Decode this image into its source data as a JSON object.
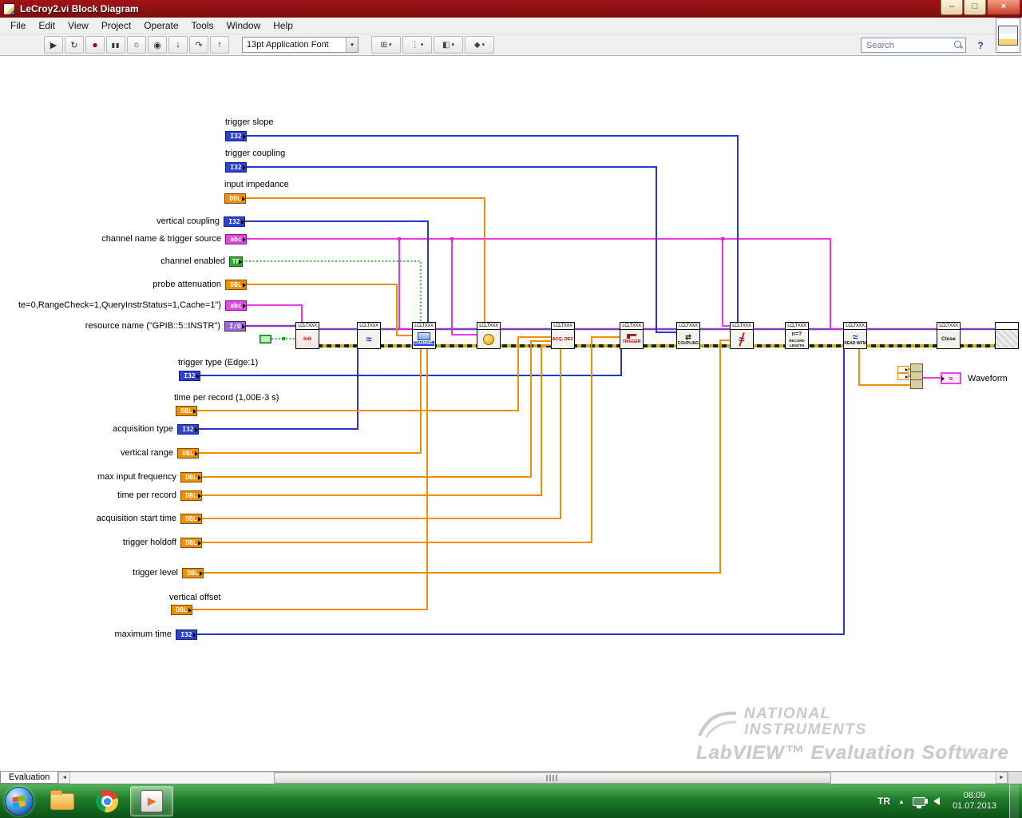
{
  "window": {
    "title": "LeCroy2.vi Block Diagram",
    "minimize_glyph": "–",
    "maximize_glyph": "□",
    "close_glyph": "×"
  },
  "menubar": {
    "items": [
      "File",
      "Edit",
      "View",
      "Project",
      "Operate",
      "Tools",
      "Window",
      "Help"
    ]
  },
  "toolbar": {
    "buttons": [
      {
        "id": "run",
        "glyph": "▶"
      },
      {
        "id": "run-continuously",
        "glyph": "↻"
      },
      {
        "id": "abort",
        "glyph": "●"
      },
      {
        "id": "pause",
        "glyph": "▮▮"
      },
      {
        "id": "highlight-execution",
        "glyph": "☼"
      },
      {
        "id": "retain-wire-values",
        "glyph": "◉"
      },
      {
        "id": "step-into",
        "glyph": "↓"
      },
      {
        "id": "step-over",
        "glyph": "↷"
      },
      {
        "id": "step-out",
        "glyph": "↑"
      }
    ],
    "font_selector": "13pt Application Font",
    "caret": "▾",
    "dropdowns": [
      {
        "id": "align-objects",
        "glyph": "⊞"
      },
      {
        "id": "distribute-objects",
        "glyph": "⋮"
      },
      {
        "id": "reorder-objects",
        "glyph": "◧"
      },
      {
        "id": "clean-up-diagram",
        "glyph": "◆"
      }
    ],
    "search_placeholder": "Search",
    "help_glyph": "?"
  },
  "diagram": {
    "terminals": [
      {
        "label": "trigger slope",
        "type": "I32"
      },
      {
        "label": "trigger coupling",
        "type": "I32"
      },
      {
        "label": "input impedance",
        "type": "DBL"
      },
      {
        "label": "vertical coupling",
        "type": "I32"
      },
      {
        "label": "channel name & trigger source",
        "type": "abc"
      },
      {
        "label": "channel enabled",
        "type": "TF"
      },
      {
        "label": "probe attenuation",
        "type": "DBL"
      },
      {
        "label": "te=0,RangeCheck=1,QueryInstrStatus=1,Cache=1\")",
        "type": "abc"
      },
      {
        "label": "resource name (\"GPIB::5::INSTR\")",
        "type": "I/O"
      },
      {
        "label": "trigger type (Edge:1)",
        "type": "I32"
      },
      {
        "label": "time per record (1,00E-3 s)",
        "type": "DBL"
      },
      {
        "label": "acquisition type",
        "type": "I32"
      },
      {
        "label": "vertical range",
        "type": "DBL"
      },
      {
        "label": "max input frequency",
        "type": "DBL"
      },
      {
        "label": "time per record",
        "type": "DBL"
      },
      {
        "label": "acquisition start time",
        "type": "DBL"
      },
      {
        "label": "trigger holdoff",
        "type": "DBL"
      },
      {
        "label": "trigger level",
        "type": "DBL"
      },
      {
        "label": "vertical offset",
        "type": "DBL"
      },
      {
        "label": "maximum time",
        "type": "I32"
      }
    ],
    "nodes": [
      {
        "header": "LCLTXXX",
        "caption": "Init",
        "glyph": ""
      },
      {
        "header": "LCLTXXX",
        "caption": "",
        "glyph": "≈"
      },
      {
        "header": "LCLTXXX",
        "caption": "CHANNEL",
        "glyph": ""
      },
      {
        "header": "LCLTXXX",
        "caption": "",
        "glyph": ""
      },
      {
        "header": "LCLTXXX",
        "caption": "ACQ. REC",
        "glyph": ""
      },
      {
        "header": "LCLTXXX",
        "caption": "TRIGGER",
        "glyph": ""
      },
      {
        "header": "LCLTXXX",
        "caption": "COUPLING",
        "glyph": "⇄"
      },
      {
        "header": "LCLTXXX",
        "caption": "",
        "glyph": "≈"
      },
      {
        "header": "LCLTXXX",
        "caption": "RECORD LENGTH",
        "glyph": "n=?"
      },
      {
        "header": "LCLTXXX",
        "caption": "READ WFM",
        "glyph": "≈"
      },
      {
        "header": "LCLTXXX",
        "caption": "Close",
        "glyph": ""
      },
      {
        "header": "",
        "caption": "",
        "glyph": ""
      }
    ],
    "indicator": {
      "label": "Waveform",
      "glyph": "≈"
    },
    "watermark": {
      "line1": "NATIONAL",
      "line2": "INSTRUMENTS",
      "product": "LabVIEW™ Evaluation Software"
    }
  },
  "statusbar": {
    "tab": "Evaluation",
    "scroll_left_glyph": "◄",
    "scroll_right_glyph": "►"
  },
  "taskbar": {
    "labview_glyph": "▶",
    "tray_chevron": "▲",
    "language": "TR",
    "time": "08:09",
    "date": "01.07.2013"
  },
  "colors": {
    "titlebar1": "#a21318",
    "titlebar2": "#7a0d10",
    "wire-i32": "#2836cf",
    "wire-dbl": "#f09000",
    "wire-str": "#e81ee8",
    "wire-visa": "#7d3fbe",
    "wire-bool": "#00b400",
    "wire-err1": "#c8b400",
    "wire-err2": "#1f1f00",
    "t-i32": "#2b43d6",
    "t-dbl": "#f09000",
    "t-str": "#e14ae1",
    "t-visa": "#9a6ad8",
    "t-bool": "#2fae2f",
    "taskbar1": "#55b35c",
    "taskbar2": "#0c5317"
  }
}
